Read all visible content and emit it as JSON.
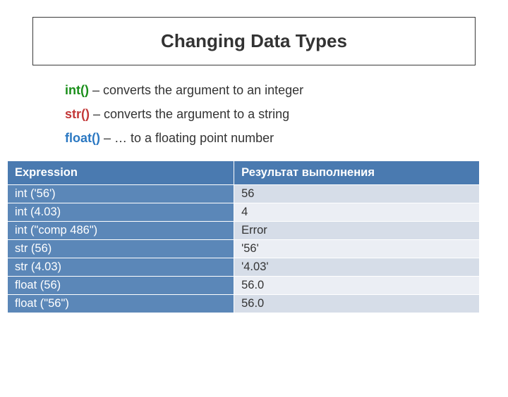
{
  "title": "Changing Data Types",
  "defs": {
    "int": {
      "fn": "int()",
      "desc": " – converts the argument to an integer"
    },
    "str": {
      "fn": "str()",
      "desc": " – converts the argument to a string"
    },
    "float": {
      "fn": "float()",
      "desc": " – … to a floating point number"
    }
  },
  "table": {
    "headers": {
      "expr": "Expression",
      "res": "Результат выполнения"
    },
    "rows": [
      {
        "expr": "int ('56')",
        "res": "56"
      },
      {
        "expr": "int (4.03)",
        "res": "4"
      },
      {
        "expr": "int (\"comp 486\")",
        "res": "Error"
      },
      {
        "expr": "str (56)",
        "res": "'56'"
      },
      {
        "expr": "str (4.03)",
        "res": "'4.03'"
      },
      {
        "expr": "float (56)",
        "res": "56.0"
      },
      {
        "expr": "float (\"56\")",
        "res": "56.0"
      }
    ]
  }
}
